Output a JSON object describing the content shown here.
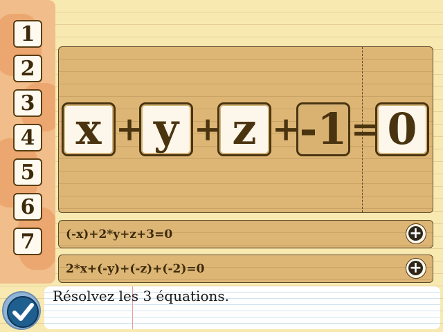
{
  "sidebar": {
    "numbers": [
      "1",
      "2",
      "3",
      "4",
      "5",
      "6",
      "7"
    ]
  },
  "equation": {
    "tiles": [
      "x",
      "y",
      "z",
      "-1",
      "0"
    ],
    "ops": [
      "+",
      "+",
      "+",
      "="
    ]
  },
  "rows": [
    {
      "text": "(-x)+2*y+z+3=0",
      "button_icon": "plus-circle-icon"
    },
    {
      "text": "2*x+(-y)+(-z)+(-2)=0",
      "button_icon": "plus-circle-icon"
    }
  ],
  "instruction": "Résolvez les 3 équations.",
  "colors": {
    "background": "#f8e9b0",
    "panel": "#ddb676",
    "tile_border": "#4a3410",
    "check": "#1f5f8f"
  }
}
